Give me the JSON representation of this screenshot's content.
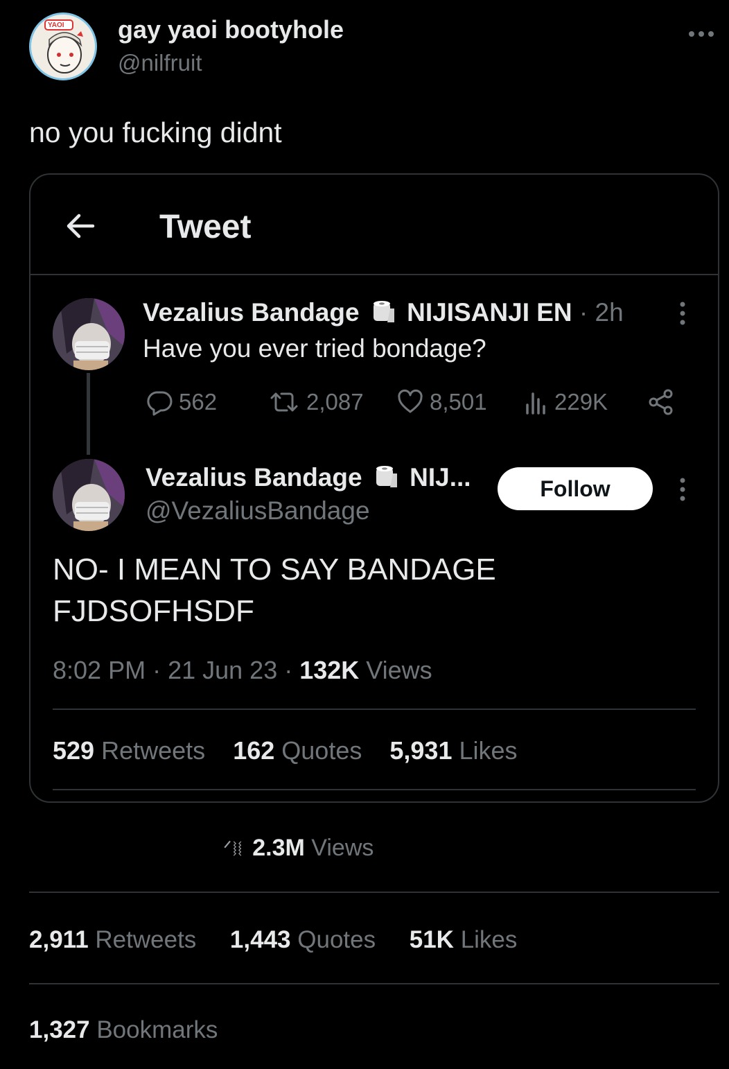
{
  "outer_post": {
    "display_name": "gay yaoi bootyhole",
    "handle": "@nilfruit",
    "more_icon": "more-horizontal-icon",
    "text": "no you fucking didnt",
    "avatar_badge": "YAOI",
    "views_count": "2.3M",
    "views_label": "Views",
    "views_prefix_glyphs": "ᐟ⧘⧙",
    "stats": {
      "retweets_count": "2,911",
      "retweets_label": "Retweets",
      "quotes_count": "1,443",
      "quotes_label": "Quotes",
      "likes_count": "51K",
      "likes_label": "Likes",
      "bookmarks_count": "1,327",
      "bookmarks_label": "Bookmarks"
    }
  },
  "embedded": {
    "screen_title": "Tweet",
    "back_icon": "arrow-left-icon",
    "first_tweet": {
      "name": "Vezalius Bandage",
      "affiliation": "NIJISANJI EN",
      "separator": " · ",
      "time": "2h",
      "text": "Have you ever tried bondage?",
      "metrics": {
        "replies": "562",
        "retweets": "2,087",
        "likes": "8,501",
        "views": "229K"
      }
    },
    "reply_tweet": {
      "name": "Vezalius Bandage",
      "affiliation": "NIJ...",
      "handle": "@VezaliusBandage",
      "follow_label": "Follow",
      "text_line1": "NO- I MEAN TO SAY BANDAGE",
      "text_line2": "FJDSOFHSDF",
      "time": "8:02 PM",
      "date": "21 Jun 23",
      "views_count": "132K",
      "views_label": "Views",
      "stats": {
        "retweets_count": "529",
        "retweets_label": "Retweets",
        "quotes_count": "162",
        "quotes_label": "Quotes",
        "likes_count": "5,931",
        "likes_label": "Likes"
      }
    }
  }
}
